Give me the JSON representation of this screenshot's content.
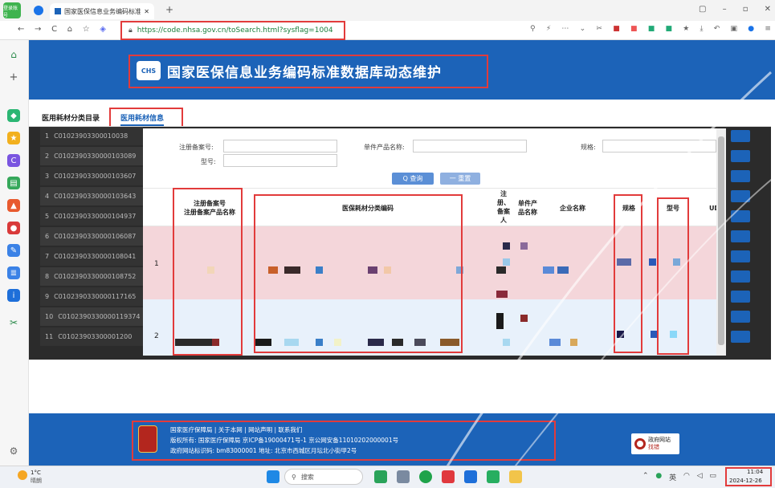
{
  "browser": {
    "tab_title": "国家医保信息业务编码标准数据库",
    "url": "https://code.nhsa.gov.cn/toSearch.html?sysflag=1004",
    "profile_label": "登录账号"
  },
  "header": {
    "title": "国家医保信息业务编码标准数据库动态维护",
    "logo_text": "CHS"
  },
  "page_tabs": [
    "医用耗材分类目录",
    "医用耗材信息"
  ],
  "bg_rows": [
    {
      "num": "1",
      "code": "C01023903300010038"
    },
    {
      "num": "2",
      "code": "C0102390330000103089"
    },
    {
      "num": "3",
      "code": "C0102390330000103607"
    },
    {
      "num": "4",
      "code": "C0102390330000103643"
    },
    {
      "num": "5",
      "code": "C0102390330000104937"
    },
    {
      "num": "6",
      "code": "C0102390330000106087"
    },
    {
      "num": "7",
      "code": "C0102390330000108041"
    },
    {
      "num": "8",
      "code": "C0102390330000108752"
    },
    {
      "num": "9",
      "code": "C0102390330000117165"
    },
    {
      "num": "10",
      "code": "C0102390330000119374"
    },
    {
      "num": "11",
      "code": "C01023903300001200"
    }
  ],
  "form": {
    "reg_no_label": "注册备案号:",
    "product_name_label": "单件产品名称:",
    "spec_label": "规格:",
    "model_label": "型号:",
    "search_btn": "Q 查询",
    "reset_btn": "一 重置"
  },
  "table": {
    "headers": {
      "reg": "注册备案号\n注册备案产品名称",
      "classcode": "医保耗材分类编码",
      "registrant": "注\n册、\n备案\n人",
      "product": "单件产\n品名称",
      "company": "企业名称",
      "spec": "规格",
      "model": "型号",
      "udi": "UDI"
    },
    "rows": [
      {
        "index": "1"
      },
      {
        "index": "2"
      }
    ]
  },
  "footer": {
    "line1": "国家医疗保障局  |  关于本网  |  网站声明  |  联系我们",
    "line2": "版权所有: 国家医疗保障局    京ICP备19000471号-1     京公网安备11010202000001号",
    "line3": "政府网站标识码: bm83000001    地址: 北京市西城区月坛北小街甲2号",
    "gov_badge_line1": "政府网站",
    "gov_badge_line2": "找错"
  },
  "taskbar": {
    "weather_temp": "1°C",
    "weather_desc": "晴朗",
    "search": "搜索",
    "ime": "英",
    "time": "11:04",
    "date": "2024-12-26"
  },
  "colors": {
    "brand_blue": "#1c63b8",
    "highlight_red": "#e23b3b",
    "row_pink": "#f4d6da",
    "row_blue": "#e8f1fb"
  }
}
